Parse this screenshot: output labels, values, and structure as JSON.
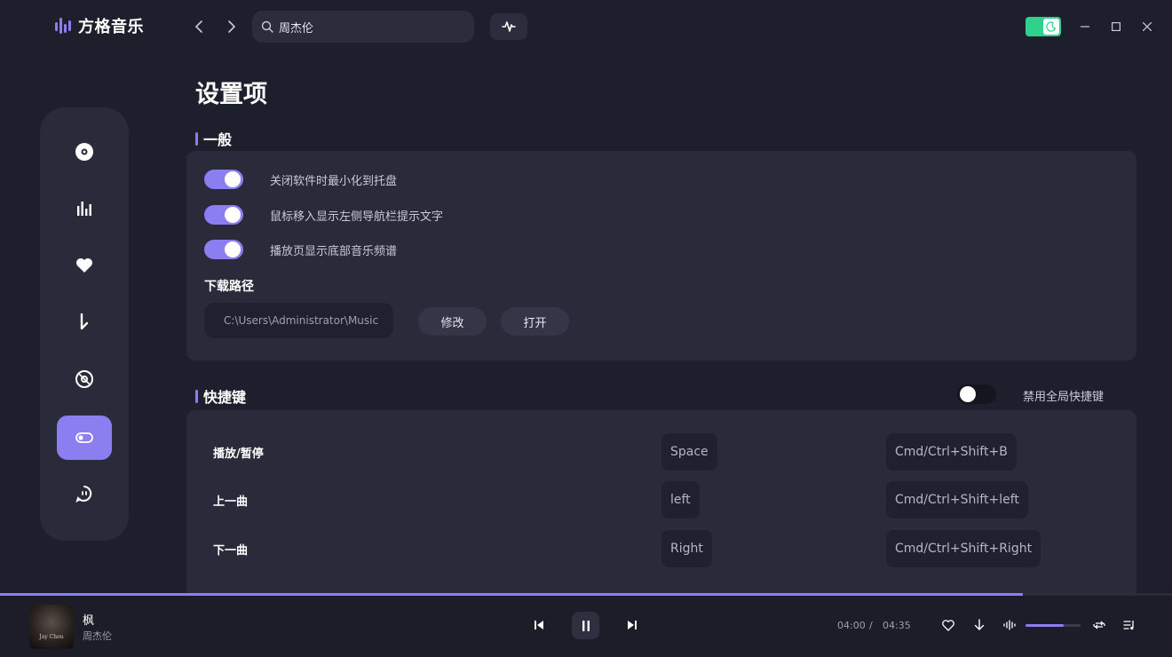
{
  "app": {
    "name": "方格音乐"
  },
  "header": {
    "search": {
      "value": "周杰伦",
      "placeholder": ""
    }
  },
  "sidebar": {
    "items": [
      {
        "id": "disc",
        "icon": "disc-icon"
      },
      {
        "id": "charts",
        "icon": "bar-chart-icon"
      },
      {
        "id": "favorites",
        "icon": "heart-icon"
      },
      {
        "id": "downloads",
        "icon": "download-icon"
      },
      {
        "id": "cd",
        "icon": "cd-icon"
      },
      {
        "id": "settings",
        "icon": "toggle-icon",
        "active": true
      },
      {
        "id": "about",
        "icon": "chat-icon"
      }
    ]
  },
  "settings": {
    "title": "设置项",
    "general": {
      "title": "一般",
      "options": [
        {
          "label": "关闭软件时最小化到托盘",
          "on": true
        },
        {
          "label": "鼠标移入显示左侧导航栏提示文字",
          "on": true
        },
        {
          "label": "播放页显示底部音乐频谱",
          "on": true
        }
      ],
      "download_path_label": "下载路径",
      "download_path": "C:\\Users\\Administrator\\Music",
      "modify_label": "修改",
      "open_label": "打开"
    },
    "hotkeys": {
      "title": "快捷键",
      "global_disable_label": "禁用全局快捷键",
      "global_disabled": false,
      "rows": [
        {
          "name": "播放/暂停",
          "key": "Space",
          "global": "Cmd/Ctrl+Shift+B"
        },
        {
          "name": "上一曲",
          "key": "left",
          "global": "Cmd/Ctrl+Shift+left"
        },
        {
          "name": "下一曲",
          "key": "Right",
          "global": "Cmd/Ctrl+Shift+Right"
        }
      ]
    }
  },
  "player": {
    "song": "枫",
    "artist": "周杰伦",
    "cover_text": "Jay Chou",
    "current_time": "04:00",
    "separator": "/",
    "total_time": "04:35",
    "progress": 0.873,
    "volume": 0.7,
    "playing": true
  },
  "colors": {
    "accent": "#8b7ef0",
    "theme_toggle": "#2fd28c",
    "background": "#1e1f2c",
    "card": "#2a2b3a"
  }
}
